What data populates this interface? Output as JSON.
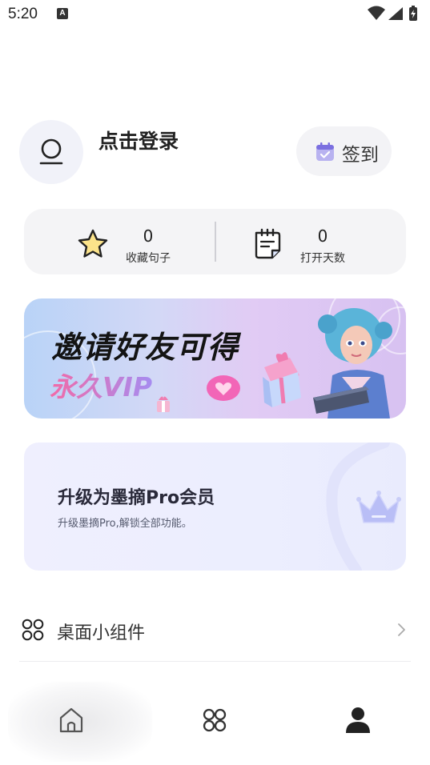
{
  "status_bar": {
    "time": "5:20",
    "notification_icon": "A"
  },
  "profile": {
    "login_text": "点击登录",
    "checkin_label": "签到"
  },
  "stats": [
    {
      "value": "0",
      "label": "收藏句子",
      "icon": "star-icon"
    },
    {
      "value": "0",
      "label": "打开天数",
      "icon": "notepad-icon"
    }
  ],
  "banner": {
    "title": "邀请好友可得",
    "subtitle": "永久VIP"
  },
  "pro": {
    "title": "升级为墨摘Pro会员",
    "subtitle": "升级墨摘Pro,解锁全部功能。"
  },
  "menu": {
    "widget_label": "桌面小组件"
  },
  "nav": {
    "items": [
      "home-icon",
      "apps-icon",
      "profile-icon"
    ],
    "active_index": 2
  },
  "colors": {
    "accent_purple": "#7b6fe0",
    "banner_pink": "#f26aa7"
  }
}
